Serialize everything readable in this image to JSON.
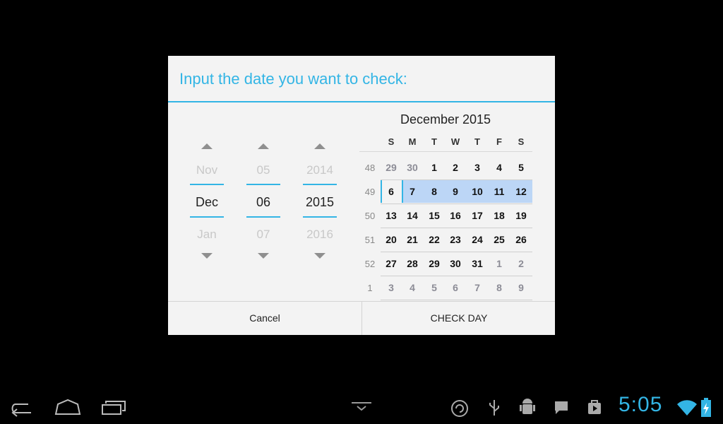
{
  "dialog": {
    "title": "Input the date you want to check:",
    "pickers": [
      {
        "prev": "Nov",
        "current": "Dec",
        "next": "Jan"
      },
      {
        "prev": "05",
        "current": "06",
        "next": "07"
      },
      {
        "prev": "2014",
        "current": "2015",
        "next": "2016"
      }
    ],
    "calendar": {
      "month_title": "December 2015",
      "weekdays": [
        "S",
        "M",
        "T",
        "W",
        "T",
        "F",
        "S"
      ],
      "weeks": [
        {
          "num": "48",
          "days": [
            "29",
            "30",
            "1",
            "2",
            "3",
            "4",
            "5"
          ],
          "other": [
            true,
            true,
            false,
            false,
            false,
            false,
            false
          ]
        },
        {
          "num": "49",
          "days": [
            "6",
            "7",
            "8",
            "9",
            "10",
            "11",
            "12"
          ],
          "other": [
            false,
            false,
            false,
            false,
            false,
            false,
            false
          ]
        },
        {
          "num": "50",
          "days": [
            "13",
            "14",
            "15",
            "16",
            "17",
            "18",
            "19"
          ],
          "other": [
            false,
            false,
            false,
            false,
            false,
            false,
            false
          ]
        },
        {
          "num": "51",
          "days": [
            "20",
            "21",
            "22",
            "23",
            "24",
            "25",
            "26"
          ],
          "other": [
            false,
            false,
            false,
            false,
            false,
            false,
            false
          ]
        },
        {
          "num": "52",
          "days": [
            "27",
            "28",
            "29",
            "30",
            "31",
            "1",
            "2"
          ],
          "other": [
            false,
            false,
            false,
            false,
            false,
            true,
            true
          ]
        },
        {
          "num": "1",
          "days": [
            "3",
            "4",
            "5",
            "6",
            "7",
            "8",
            "9"
          ],
          "other": [
            true,
            true,
            true,
            true,
            true,
            true,
            true
          ]
        }
      ],
      "selected_day": "6",
      "selected_week": "49"
    },
    "buttons": {
      "cancel": "Cancel",
      "confirm": "CHECK DAY"
    }
  },
  "system_bar": {
    "time": "5:05",
    "nav_icons": [
      "back-icon",
      "home-icon",
      "recent-apps-icon",
      "keyboard-hide-icon"
    ],
    "status_icons": [
      "sync-icon",
      "usb-icon",
      "android-debug-icon",
      "message-icon",
      "play-store-icon",
      "wifi-icon",
      "battery-charging-icon"
    ]
  }
}
